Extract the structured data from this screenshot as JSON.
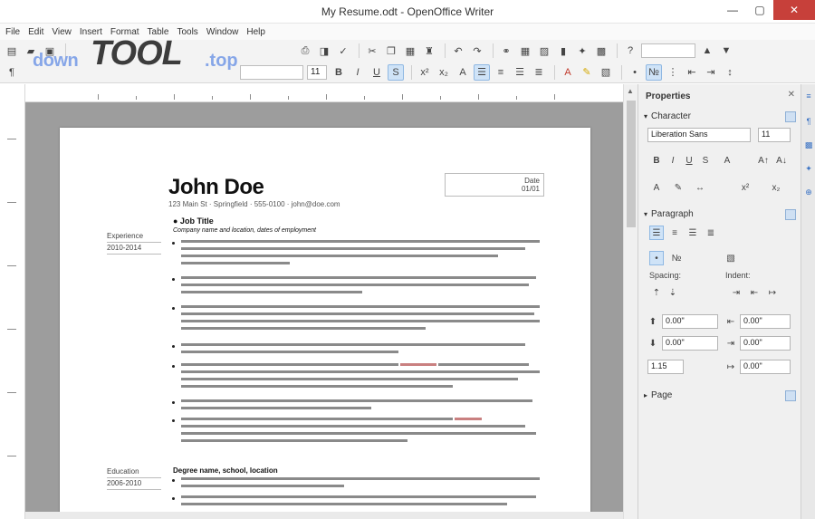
{
  "window": {
    "title": "My Resume.odt - OpenOffice Writer"
  },
  "menu": [
    "File",
    "Edit",
    "View",
    "Insert",
    "Format",
    "Table",
    "Tools",
    "Window",
    "Help"
  ],
  "logo": {
    "part1": "down",
    "part2": "TOOL",
    "part3": ".top"
  },
  "toolbar": {
    "font_size": "11"
  },
  "resume": {
    "name": "John Doe",
    "contact": "123 Main St · Springfield · 555-0100 · john@doe.com",
    "date_line1": "Date",
    "date_line2": "01/01",
    "side1": "Experience",
    "side1b": "2010-2014",
    "side2": "Education",
    "side2b": "2006-2010",
    "section1": "● Job Title",
    "section1_sub": "Company name and location, dates of employment",
    "section2": "Degree name, school, location"
  },
  "sidebar": {
    "title": "Properties",
    "section_character": "Character",
    "font_name": "Liberation Sans",
    "font_size": "11",
    "section_paragraph": "Paragraph",
    "label_spacing": "Spacing:",
    "label_indent": "Indent:",
    "spacing_above": "0.00\"",
    "spacing_below": "0.00\"",
    "indent_before": "0.00\"",
    "indent_after": "0.00\"",
    "indent_first": "0.00\"",
    "line_spacing": "1.15",
    "section_page": "Page"
  }
}
